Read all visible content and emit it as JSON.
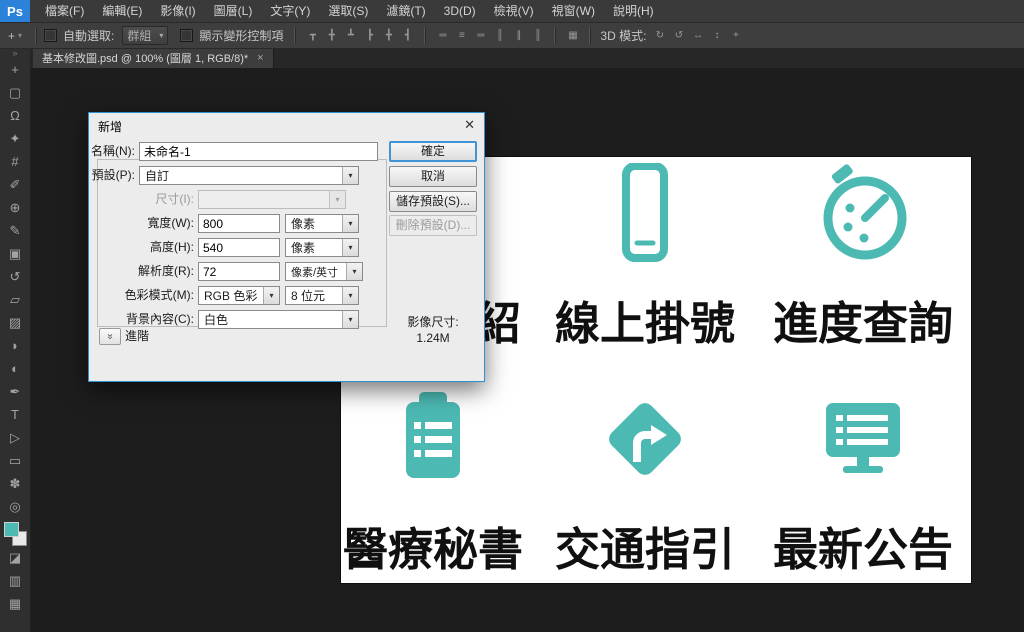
{
  "icons": {
    "dropdown_arrow": "▾",
    "advanced_chevron": "»",
    "collapse_double": "»"
  },
  "menu_bar": {
    "logo": "Ps",
    "items": [
      "檔案(F)",
      "編輯(E)",
      "影像(I)",
      "圖層(L)",
      "文字(Y)",
      "選取(S)",
      "濾鏡(T)",
      "3D(D)",
      "檢視(V)",
      "視窗(W)",
      "說明(H)"
    ]
  },
  "options_bar": {
    "tool_icon": {
      "name": "move-tool-icon",
      "glyph": "+"
    },
    "auto_select_label": "自動選取:",
    "auto_select_value": "群組",
    "show_transform_label": "顯示變形控制項",
    "align_icons": [
      {
        "name": "align-top-edges-icon",
        "glyph": "┳"
      },
      {
        "name": "align-vertical-centers-icon",
        "glyph": "╋"
      },
      {
        "name": "align-bottom-edges-icon",
        "glyph": "┻"
      },
      {
        "name": "align-left-edges-icon",
        "glyph": "┣"
      },
      {
        "name": "align-horizontal-centers-icon",
        "glyph": "╋"
      },
      {
        "name": "align-right-edges-icon",
        "glyph": "┫"
      }
    ],
    "distribute_icons": [
      {
        "name": "distribute-top-edges-icon",
        "glyph": "═"
      },
      {
        "name": "distribute-vertical-centers-icon",
        "glyph": "≡"
      },
      {
        "name": "distribute-bottom-edges-icon",
        "glyph": "═"
      },
      {
        "name": "distribute-left-edges-icon",
        "glyph": "║"
      },
      {
        "name": "distribute-horizontal-centers-icon",
        "glyph": "∥"
      },
      {
        "name": "distribute-right-edges-icon",
        "glyph": "║"
      }
    ],
    "extra_icons": [
      {
        "name": "auto-align-layers-icon",
        "glyph": "▦"
      }
    ],
    "mode_3d_label": "3D 模式:",
    "mode_3d_icons": [
      {
        "name": "3d-rotate-icon",
        "glyph": "↻"
      },
      {
        "name": "3d-roll-icon",
        "glyph": "↺"
      },
      {
        "name": "3d-drag-icon",
        "glyph": "↔"
      },
      {
        "name": "3d-slide-icon",
        "glyph": "↕"
      },
      {
        "name": "3d-scale-icon",
        "glyph": "+"
      }
    ]
  },
  "tab_bar": {
    "title": "基本修改圖.psd @ 100% (圖層 1, RGB/8)*",
    "close": "×"
  },
  "toolbar": {
    "foreground_color": "#4cb9b3",
    "tools": [
      {
        "name": "move-tool",
        "glyph": "+"
      },
      {
        "name": "marquee-tool",
        "glyph": "▢"
      },
      {
        "name": "lasso-tool",
        "glyph": "Ω"
      },
      {
        "name": "quick-selection-tool",
        "glyph": "✦"
      },
      {
        "name": "crop-tool",
        "glyph": "#"
      },
      {
        "name": "eyedropper-tool",
        "glyph": "✐"
      },
      {
        "name": "healing-brush-tool",
        "glyph": "⊕"
      },
      {
        "name": "brush-tool",
        "glyph": "✎"
      },
      {
        "name": "clone-stamp-tool",
        "glyph": "▣"
      },
      {
        "name": "history-brush-tool",
        "glyph": "↺"
      },
      {
        "name": "eraser-tool",
        "glyph": "▱"
      },
      {
        "name": "gradient-tool",
        "glyph": "▨"
      },
      {
        "name": "blur-tool",
        "glyph": "◗"
      },
      {
        "name": "dodge-tool",
        "glyph": "◐"
      },
      {
        "name": "pen-tool",
        "glyph": "✒"
      },
      {
        "name": "type-tool",
        "glyph": "T"
      },
      {
        "name": "path-selection-tool",
        "glyph": "▷"
      },
      {
        "name": "shape-tool",
        "glyph": "▭"
      },
      {
        "name": "hand-tool",
        "glyph": "✽"
      },
      {
        "name": "zoom-tool",
        "glyph": "◎"
      }
    ],
    "bottom_icons": [
      {
        "name": "quick-mask-icon",
        "glyph": "◪"
      },
      {
        "name": "screen-mode-icon",
        "glyph": "▥"
      },
      {
        "name": "edit-toolbar-icon",
        "glyph": "▦"
      }
    ]
  },
  "dialog": {
    "title": "新增",
    "close": "✕",
    "name_label": "名稱(N):",
    "name_value": "未命名-1",
    "preset_label": "預設(P):",
    "preset_value": "自訂",
    "size_label": "尺寸(I):",
    "width_label": "寬度(W):",
    "width_value": "800",
    "width_unit": "像素",
    "height_label": "高度(H):",
    "height_value": "540",
    "height_unit": "像素",
    "resolution_label": "解析度(R):",
    "resolution_value": "72",
    "resolution_unit": "像素/英寸",
    "color_mode_label": "色彩模式(M):",
    "color_mode_value": "RGB 色彩",
    "bit_depth_value": "8 位元",
    "background_label": "背景內容(C):",
    "background_value": "白色",
    "advanced_label": "進階",
    "ok": "確定",
    "cancel": "取消",
    "save_preset": "儲存預設(S)...",
    "delete_preset": "刪除預設(D)...",
    "image_size_label": "影像尺寸:",
    "image_size_value": "1.24M"
  },
  "canvas": {
    "accent": "#4cb9b3",
    "cells": [
      {
        "icon": "hidden",
        "label": "紹",
        "partial": true
      },
      {
        "icon": "phone",
        "label": "線上掛號"
      },
      {
        "icon": "timer",
        "label": "進度查詢"
      },
      {
        "icon": "clipboard",
        "label": "醫療秘書"
      },
      {
        "icon": "sign",
        "label": "交通指引"
      },
      {
        "icon": "monitor",
        "label": "最新公告"
      }
    ]
  }
}
